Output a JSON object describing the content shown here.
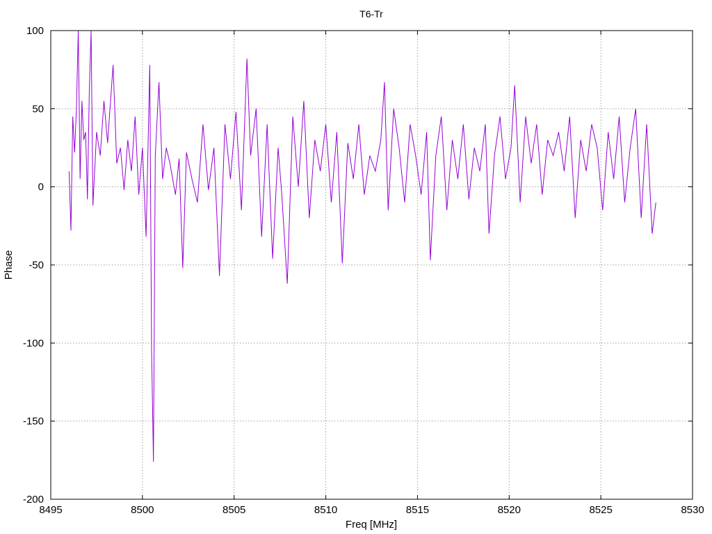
{
  "chart_data": {
    "type": "line",
    "title": "T6-Tr",
    "xlabel": "Freq [MHz]",
    "ylabel": "Phase",
    "xlim": [
      8495,
      8530
    ],
    "ylim": [
      -200,
      100
    ],
    "xticks": [
      "8495",
      "8500",
      "8505",
      "8510",
      "8515",
      "8520",
      "8525",
      "8530"
    ],
    "yticks": [
      "100",
      "50",
      "0",
      "-50",
      "-100",
      "-150",
      "-200"
    ],
    "grid": true,
    "series": [
      {
        "color": "#9400d3",
        "x": [
          8496.0,
          8496.1,
          8496.2,
          8496.3,
          8496.4,
          8496.5,
          8496.6,
          8496.7,
          8496.8,
          8496.9,
          8497.0,
          8497.1,
          8497.2,
          8497.3,
          8497.5,
          8497.7,
          8497.9,
          8498.1,
          8498.4,
          8498.6,
          8498.8,
          8499.0,
          8499.2,
          8499.4,
          8499.6,
          8499.8,
          8500.0,
          8500.2,
          8500.4,
          8500.5,
          8500.6,
          8500.7,
          8500.9,
          8501.1,
          8501.3,
          8501.5,
          8501.8,
          8502.0,
          8502.2,
          8502.4,
          8502.7,
          8503.0,
          8503.3,
          8503.6,
          8503.9,
          8504.2,
          8504.5,
          8504.8,
          8505.1,
          8505.4,
          8505.7,
          8505.9,
          8506.2,
          8506.5,
          8506.8,
          8507.1,
          8507.4,
          8507.6,
          8507.9,
          8508.2,
          8508.5,
          8508.8,
          8509.1,
          8509.4,
          8509.7,
          8510.0,
          8510.3,
          8510.6,
          8510.9,
          8511.2,
          8511.5,
          8511.8,
          8512.1,
          8512.4,
          8512.7,
          8513.0,
          8513.2,
          8513.4,
          8513.7,
          8514.0,
          8514.3,
          8514.6,
          8514.9,
          8515.2,
          8515.5,
          8515.7,
          8516.0,
          8516.3,
          8516.6,
          8516.9,
          8517.2,
          8517.5,
          8517.8,
          8518.1,
          8518.4,
          8518.7,
          8518.9,
          8519.2,
          8519.5,
          8519.8,
          8520.1,
          8520.3,
          8520.6,
          8520.9,
          8521.2,
          8521.5,
          8521.8,
          8522.1,
          8522.4,
          8522.7,
          8523.0,
          8523.3,
          8523.6,
          8523.9,
          8524.2,
          8524.5,
          8524.8,
          8525.1,
          8525.4,
          8525.7,
          8526.0,
          8526.3,
          8526.6,
          8526.9,
          8527.2,
          8527.5,
          8527.8,
          8528.0
        ],
        "y": [
          10,
          -28,
          45,
          22,
          50,
          100,
          5,
          55,
          30,
          35,
          -8,
          60,
          100,
          -12,
          35,
          20,
          55,
          28,
          78,
          15,
          25,
          -2,
          30,
          10,
          45,
          -5,
          25,
          -32,
          78,
          -105,
          -176,
          20,
          67,
          5,
          25,
          15,
          -5,
          18,
          -52,
          22,
          5,
          -10,
          40,
          -2,
          25,
          -57,
          40,
          5,
          48,
          -15,
          82,
          20,
          50,
          -32,
          40,
          -46,
          25,
          -5,
          -62,
          45,
          0,
          55,
          -20,
          30,
          10,
          40,
          -10,
          35,
          -49,
          28,
          5,
          40,
          -5,
          20,
          10,
          30,
          67,
          -15,
          50,
          25,
          -10,
          40,
          20,
          -5,
          35,
          -47,
          20,
          45,
          -15,
          30,
          5,
          40,
          -8,
          25,
          10,
          40,
          -30,
          20,
          45,
          5,
          25,
          65,
          -10,
          45,
          15,
          40,
          -5,
          30,
          20,
          35,
          10,
          45,
          -20,
          30,
          10,
          40,
          25,
          -15,
          35,
          5,
          45,
          -10,
          25,
          50,
          -20,
          40,
          -30,
          -10
        ]
      }
    ]
  }
}
